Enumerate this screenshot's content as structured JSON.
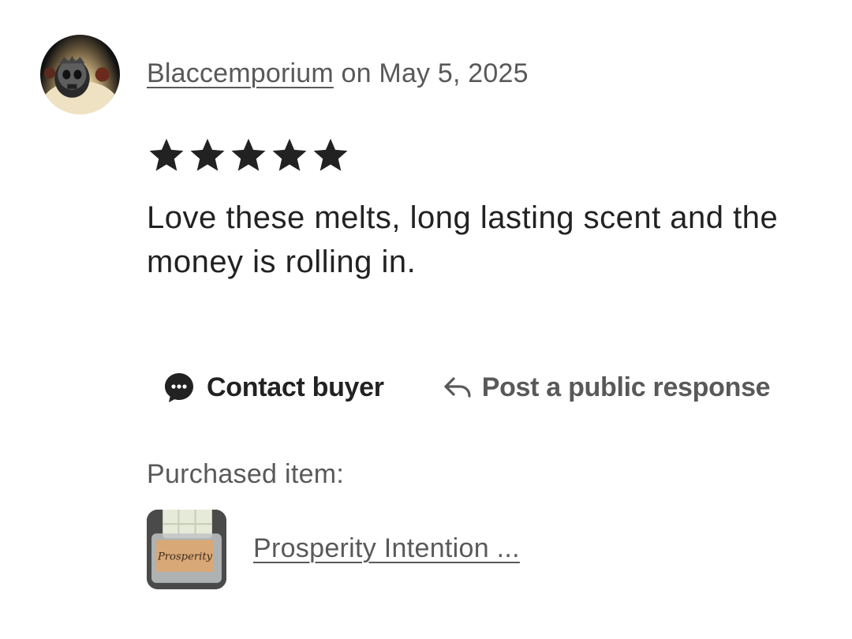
{
  "review": {
    "reviewer_name": "Blaccemporium",
    "date_text": " on May 5, 2025",
    "rating": 5,
    "rating_max": 5,
    "star_color": "#222222",
    "text": "Love these melts, long lasting scent and the money is rolling in."
  },
  "actions": {
    "contact_label": "Contact buyer",
    "contact_icon": "chat-bubble-icon",
    "respond_label": "Post a public response",
    "respond_icon": "reply-arrow-icon"
  },
  "purchase": {
    "label": "Purchased item:",
    "item_title": "Prosperity Intention ...",
    "thumbnail_label": "Prosperity"
  },
  "colors": {
    "primary_text": "#222222",
    "secondary_text": "#595959"
  }
}
